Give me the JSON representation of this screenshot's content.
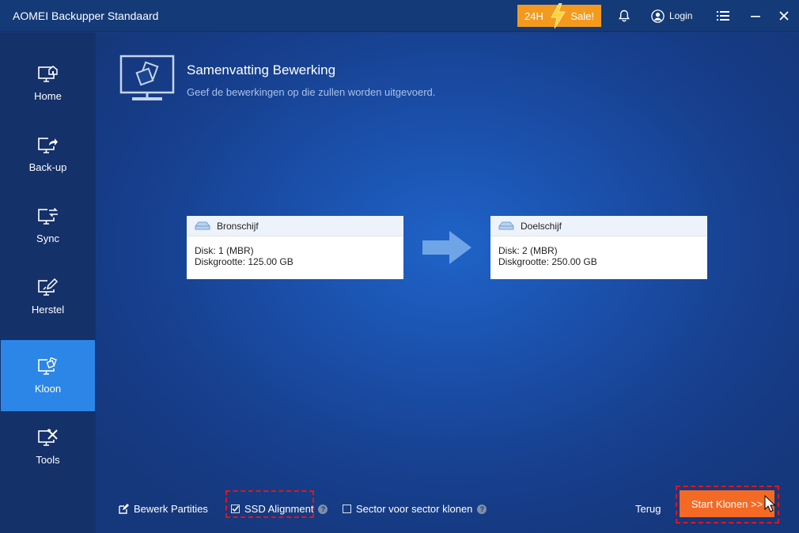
{
  "window": {
    "title": "AOMEI Backupper Standaard",
    "sale": {
      "left": "24H",
      "right": "Sale!"
    },
    "login_label": "Login"
  },
  "sidebar": {
    "items": [
      {
        "label": "Home",
        "icon": "monitor-home-icon",
        "active": false
      },
      {
        "label": "Back-up",
        "icon": "monitor-share-icon",
        "active": false
      },
      {
        "label": "Sync",
        "icon": "monitor-sync-icon",
        "active": false
      },
      {
        "label": "Herstel",
        "icon": "monitor-restore-icon",
        "active": false
      },
      {
        "label": "Kloon",
        "icon": "monitor-clone-icon",
        "active": true
      },
      {
        "label": "Tools",
        "icon": "monitor-tools-icon",
        "active": false
      }
    ]
  },
  "main": {
    "title": "Samenvatting Bewerking",
    "subtitle": "Geef de bewerkingen op die zullen worden uitgevoerd.",
    "source": {
      "title": "Bronschijf",
      "disk": "Disk: 1 (MBR)",
      "size": "Diskgrootte: 125.00 GB"
    },
    "target": {
      "title": "Doelschijf",
      "disk": "Disk: 2 (MBR)",
      "size": "Diskgrootte: 250.00 GB"
    }
  },
  "footer": {
    "edit_partitions": "Bewerk Partities",
    "ssd_alignment": "SSD Alignment",
    "ssd_alignment_checked": true,
    "sector_clone": "Sector voor sector klonen",
    "sector_clone_checked": false,
    "back_label": "Terug",
    "start_label": "Start Klonen >>"
  },
  "colors": {
    "accent": "#2b86e8",
    "start_button": "#f46a25",
    "sale_badge": "#f39a1e",
    "highlight": "#e0151b"
  }
}
